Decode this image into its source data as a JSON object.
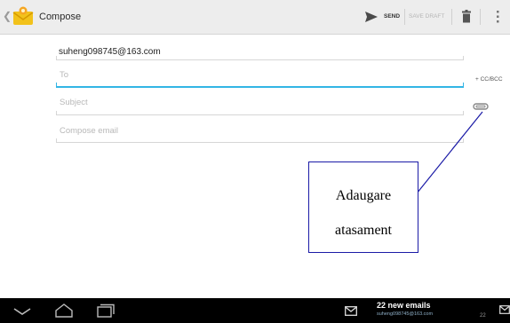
{
  "header": {
    "title": "Compose",
    "send_label": "SEND",
    "save_draft_label": "SAVE DRAFT"
  },
  "form": {
    "from": "suheng098745@163.com",
    "to_placeholder": "To",
    "subject_placeholder": "Subject",
    "body_placeholder": "Compose email",
    "cc_bcc_label": "+ CC/BCC"
  },
  "callout": {
    "line1": "Adaugare",
    "line2": "atasament"
  },
  "navbar": {
    "notification_title": "22 new emails",
    "notification_account": "suheng098745@163.com",
    "notification_count": "22"
  },
  "colors": {
    "accent": "#33b5e5",
    "callout_border": "#1a1aa6"
  },
  "icons": [
    "back-chevron-icon",
    "email-app-icon",
    "send-icon",
    "trash-icon",
    "overflow-menu-icon",
    "attachment-icon",
    "nav-back-icon",
    "nav-home-icon",
    "nav-recents-icon",
    "mail-notification-icon"
  ]
}
